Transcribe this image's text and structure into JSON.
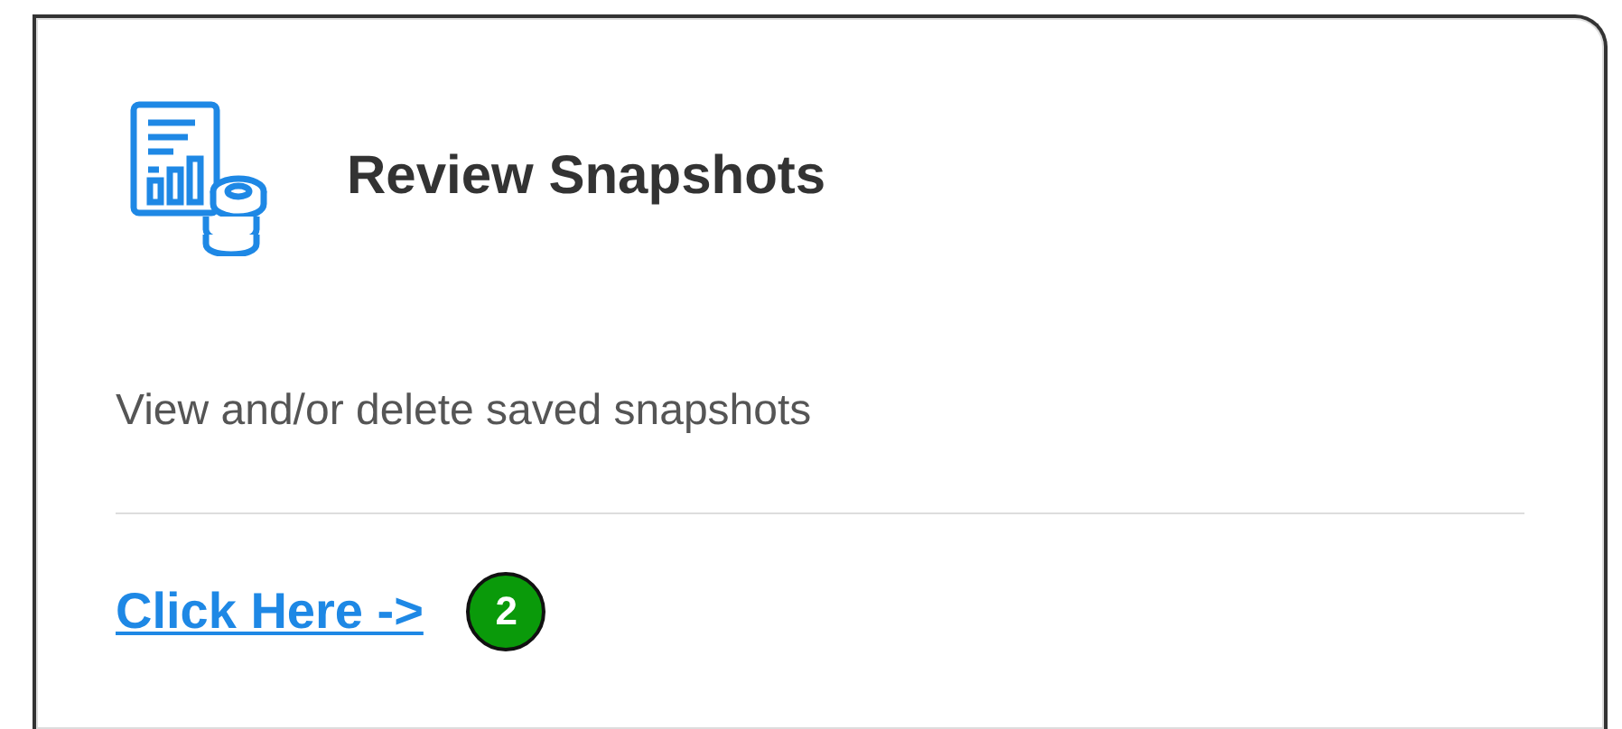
{
  "card": {
    "title": "Review Snapshots",
    "description": "View and/or delete saved snapshots",
    "link": "Click Here ->",
    "step_badge": "2"
  }
}
